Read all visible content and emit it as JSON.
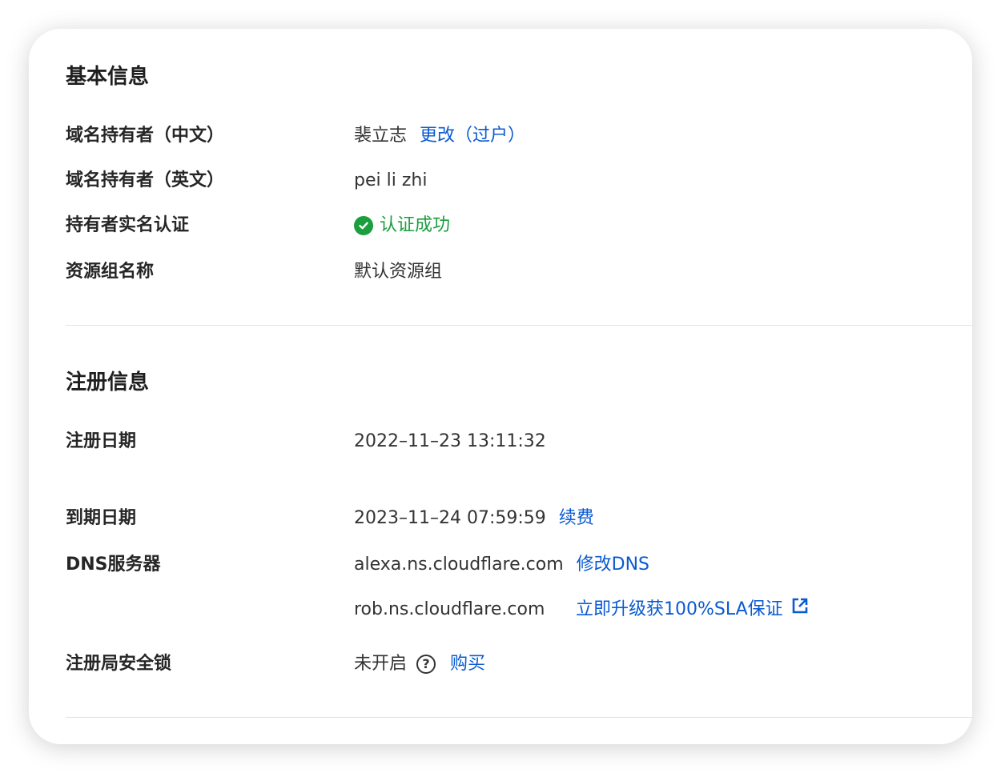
{
  "basic": {
    "title": "基本信息",
    "owner_cn_label": "域名持有者（中文）",
    "owner_cn_value": "裴立志",
    "owner_cn_link": "更改（过户）",
    "owner_en_label": "域名持有者（英文）",
    "owner_en_value": "pei li zhi",
    "verify_label": "持有者实名认证",
    "verify_value": "认证成功",
    "group_label": "资源组名称",
    "group_value": "默认资源组"
  },
  "register": {
    "title": "注册信息",
    "reg_date_label": "注册日期",
    "reg_date_value": "2022–11–23 13:11:32",
    "exp_date_label": "到期日期",
    "exp_date_value": "2023–11–24 07:59:59",
    "renew_link": "续费",
    "dns_label": "DNS服务器",
    "dns1": "alexa.ns.cloudflare.com",
    "dns_edit_link": "修改DNS",
    "dns2": "rob.ns.cloudflare.com",
    "sla_link": "立即升级获100%SLA保证",
    "lock_label": "注册局安全锁",
    "lock_value": "未开启",
    "buy_link": "购买"
  },
  "colors": {
    "link": "#0a5ad1",
    "success": "#1b9e3e"
  },
  "icons": {
    "verify": "check-circle-icon",
    "help": "question-circle-icon",
    "external": "external-link-icon"
  }
}
